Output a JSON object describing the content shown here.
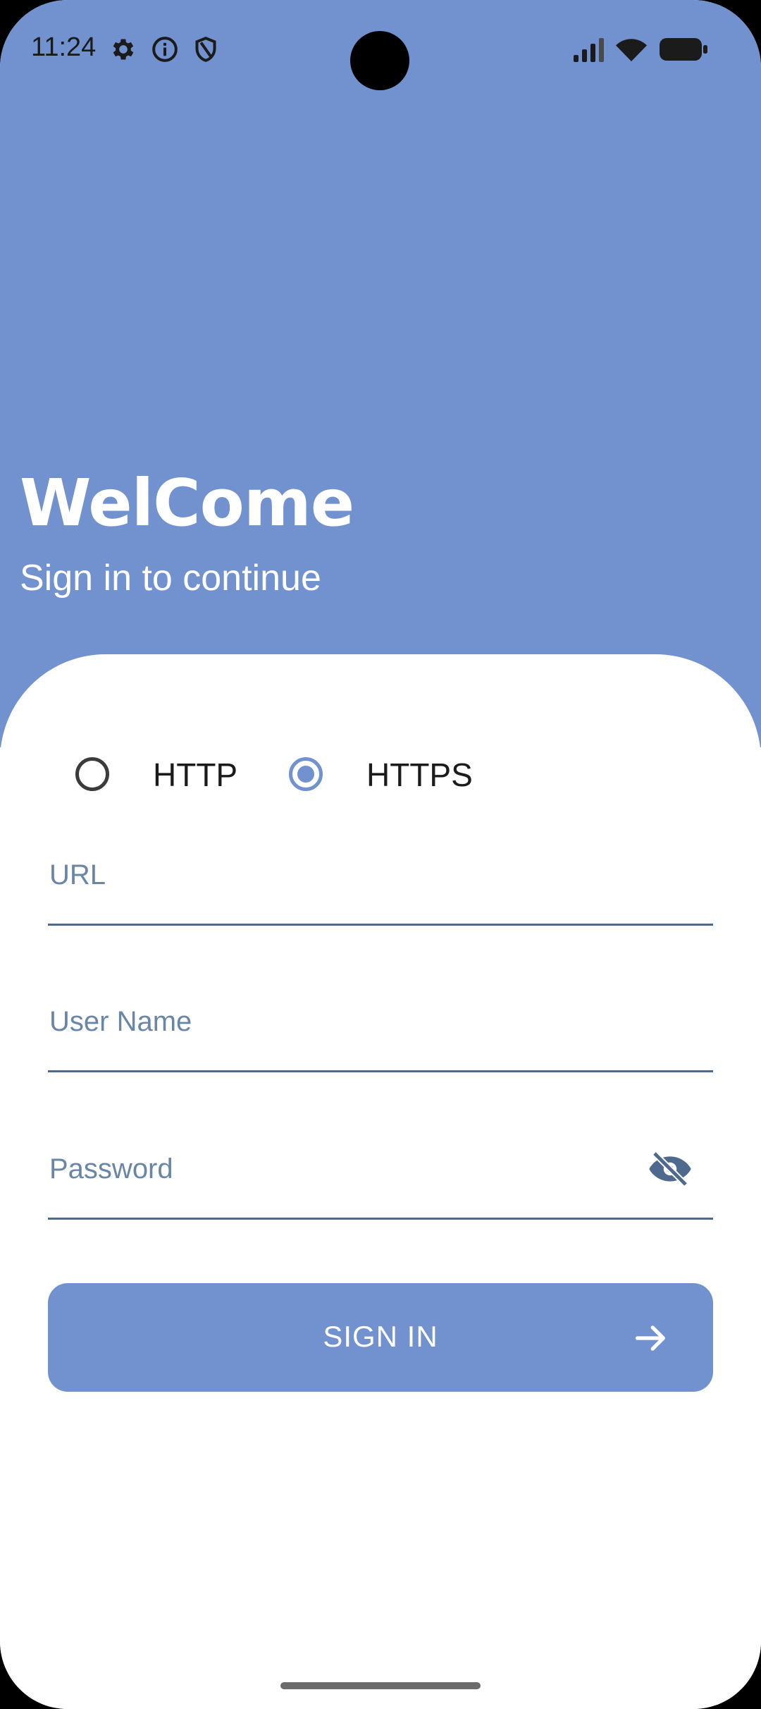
{
  "status_bar": {
    "time": "11:24",
    "left_icons": [
      "gear-icon",
      "info-icon",
      "shield-icon"
    ],
    "right_icons": [
      "signal-icon",
      "wifi-icon",
      "battery-icon"
    ]
  },
  "header": {
    "title": "WelCome",
    "subtitle": "Sign in to continue"
  },
  "protocol": {
    "options": [
      {
        "label": "HTTP",
        "selected": false
      },
      {
        "label": "HTTPS",
        "selected": true
      }
    ]
  },
  "form": {
    "url_placeholder": "URL",
    "username_placeholder": "User Name",
    "password_placeholder": "Password"
  },
  "signin": {
    "label": "SIGN IN"
  },
  "colors": {
    "accent": "#7192cf",
    "field_line": "#4d6a8e",
    "placeholder": "#6a86a6"
  }
}
